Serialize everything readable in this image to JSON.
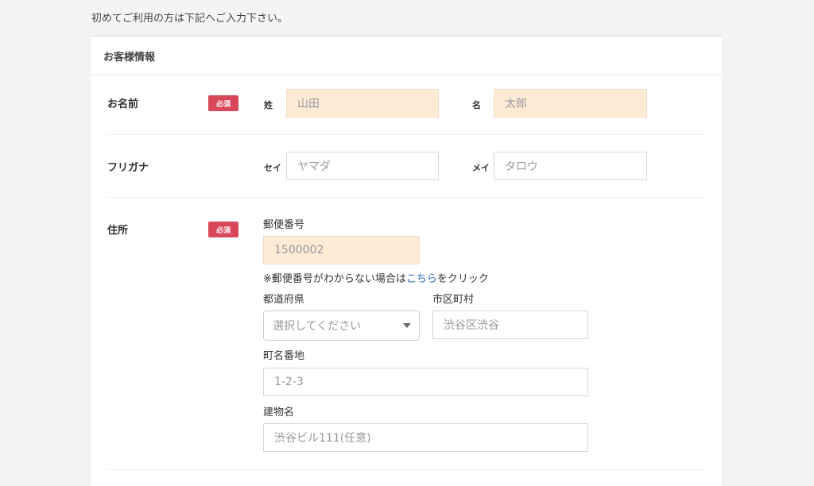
{
  "intro": "初めてご利用の方は下記へご入力下さい。",
  "section_title": "お客様情報",
  "required_badge": "必須",
  "name": {
    "label": "お名前",
    "last_label": "姓",
    "last_placeholder": "山田",
    "first_label": "名",
    "first_placeholder": "太郎"
  },
  "furigana": {
    "label": "フリガナ",
    "last_label": "セイ",
    "last_placeholder": "ヤマダ",
    "first_label": "メイ",
    "first_placeholder": "タロウ"
  },
  "address": {
    "label": "住所",
    "postal_label": "郵便番号",
    "postal_placeholder": "1500002",
    "note_prefix": "※郵便番号がわからない場合は",
    "note_link": "こちら",
    "note_suffix": "をクリック",
    "prefecture_label": "都道府県",
    "prefecture_selected": "選択してください",
    "city_label": "市区町村",
    "city_placeholder": "渋谷区渋谷",
    "street_label": "町名番地",
    "street_placeholder": "1-2-3",
    "building_label": "建物名",
    "building_placeholder": "渋谷ビル111(任意)"
  },
  "colors": {
    "required_badge": "#d9475a",
    "required_field": "#fdebd6",
    "link": "#2668b8"
  }
}
